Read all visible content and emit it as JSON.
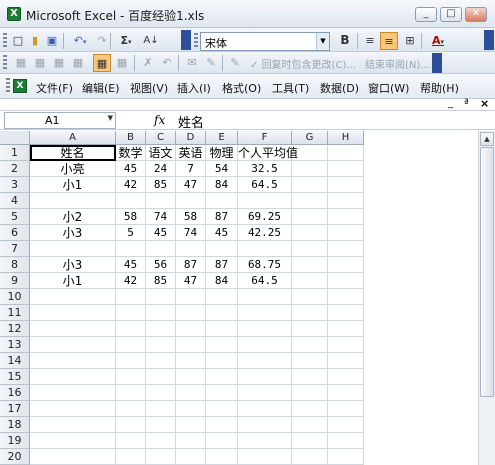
{
  "window": {
    "title": "Microsoft Excel - 百度经验1.xls",
    "minimize": "_",
    "restore": "□",
    "close": "✕"
  },
  "toolbar1": {
    "sum": "Σ",
    "sort": "A↓",
    "font_name": "宋体",
    "bold": "B",
    "font_color_label": "A"
  },
  "toolbar2": {
    "reply_changes": "回复时包含更改(C)...",
    "end_review": "结束审阅(N)..."
  },
  "menubar": {
    "items": [
      "文件(F)",
      "编辑(E)",
      "视图(V)",
      "插入(I)",
      "格式(O)",
      "工具(T)",
      "数据(D)",
      "窗口(W)",
      "帮助(H)"
    ],
    "doc_minimize": "_",
    "doc_restore": "ª",
    "doc_close": "×"
  },
  "formula_bar": {
    "name_box": "A1",
    "fx": "fx",
    "value": "姓名"
  },
  "sheet": {
    "columns": [
      "A",
      "B",
      "C",
      "D",
      "E",
      "F",
      "G",
      "H"
    ],
    "rows": [
      "1",
      "2",
      "3",
      "4",
      "5",
      "6",
      "7",
      "8",
      "9",
      "10",
      "11",
      "12",
      "13",
      "14",
      "15",
      "16",
      "17",
      "18",
      "19",
      "20"
    ],
    "cells": [
      [
        "姓名",
        "数学",
        "语文",
        "英语",
        "物理",
        "个人平均值"
      ],
      [
        "小亮",
        "45",
        "24",
        "7",
        "54",
        "32.5"
      ],
      [
        "小1",
        "42",
        "85",
        "47",
        "84",
        "64.5"
      ],
      [
        "",
        "",
        "",
        "",
        "",
        ""
      ],
      [
        "小2",
        "58",
        "74",
        "58",
        "87",
        "69.25"
      ],
      [
        "小3",
        "5",
        "45",
        "74",
        "45",
        "42.25"
      ],
      [
        "",
        "",
        "",
        "",
        "",
        ""
      ],
      [
        "小3",
        "45",
        "56",
        "87",
        "87",
        "68.75"
      ],
      [
        "小1",
        "42",
        "85",
        "47",
        "84",
        "64.5"
      ]
    ],
    "selected_cell": "A1"
  }
}
